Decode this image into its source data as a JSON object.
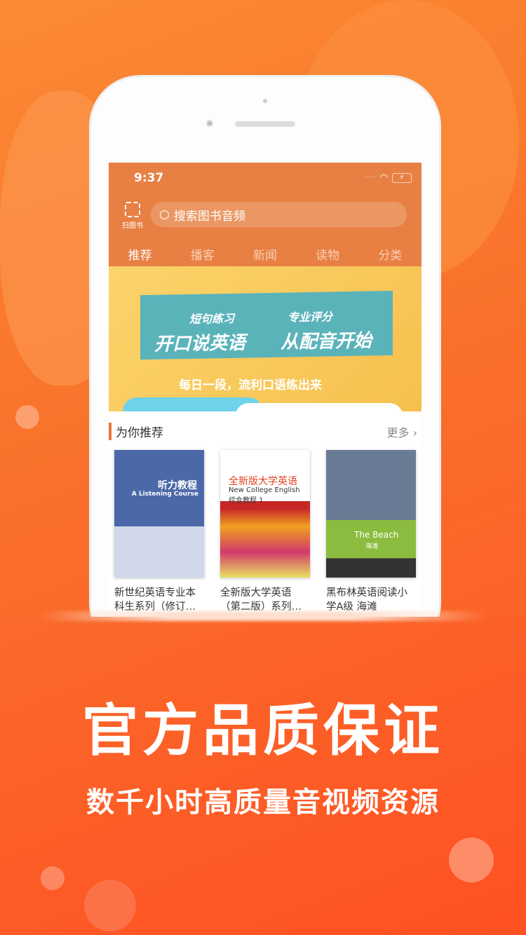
{
  "status": {
    "time": "9:37",
    "signal": "····",
    "wifi_icon": "wifi-icon",
    "battery": "⚡"
  },
  "header": {
    "scan_label": "扫图书",
    "search_placeholder": "搜索图书音频"
  },
  "tabs": [
    {
      "label": "推荐",
      "active": true
    },
    {
      "label": "播客"
    },
    {
      "label": "新闻"
    },
    {
      "label": "读物"
    },
    {
      "label": "分类"
    }
  ],
  "banner": {
    "line1a": "短句练习",
    "line1b": "专业评分",
    "line2a": "开口说英语",
    "line2b": "从配音开始",
    "slogan": "每日一段，流利口语练出来"
  },
  "recommend": {
    "title": "为你推荐",
    "more": "更多",
    "books": [
      {
        "cover_title": "听力教程",
        "cover_sub": "A Listening Course",
        "title": "新世纪英语专业本科生系列（修订…"
      },
      {
        "cover_title": "全新版大学英语",
        "cover_sub": "New College English 综合教程 1",
        "title": "全新版大学英语（第二版）系列…"
      },
      {
        "cover_title": "The Beach",
        "cover_sub": "海滩",
        "title": "黑布林英语阅读小学A级 海滩"
      }
    ]
  },
  "promo": {
    "headline": "官方品质保证",
    "subline": "数千小时高质量音视频资源"
  },
  "colors": {
    "accent": "#e88044",
    "background": "#f9702a"
  }
}
